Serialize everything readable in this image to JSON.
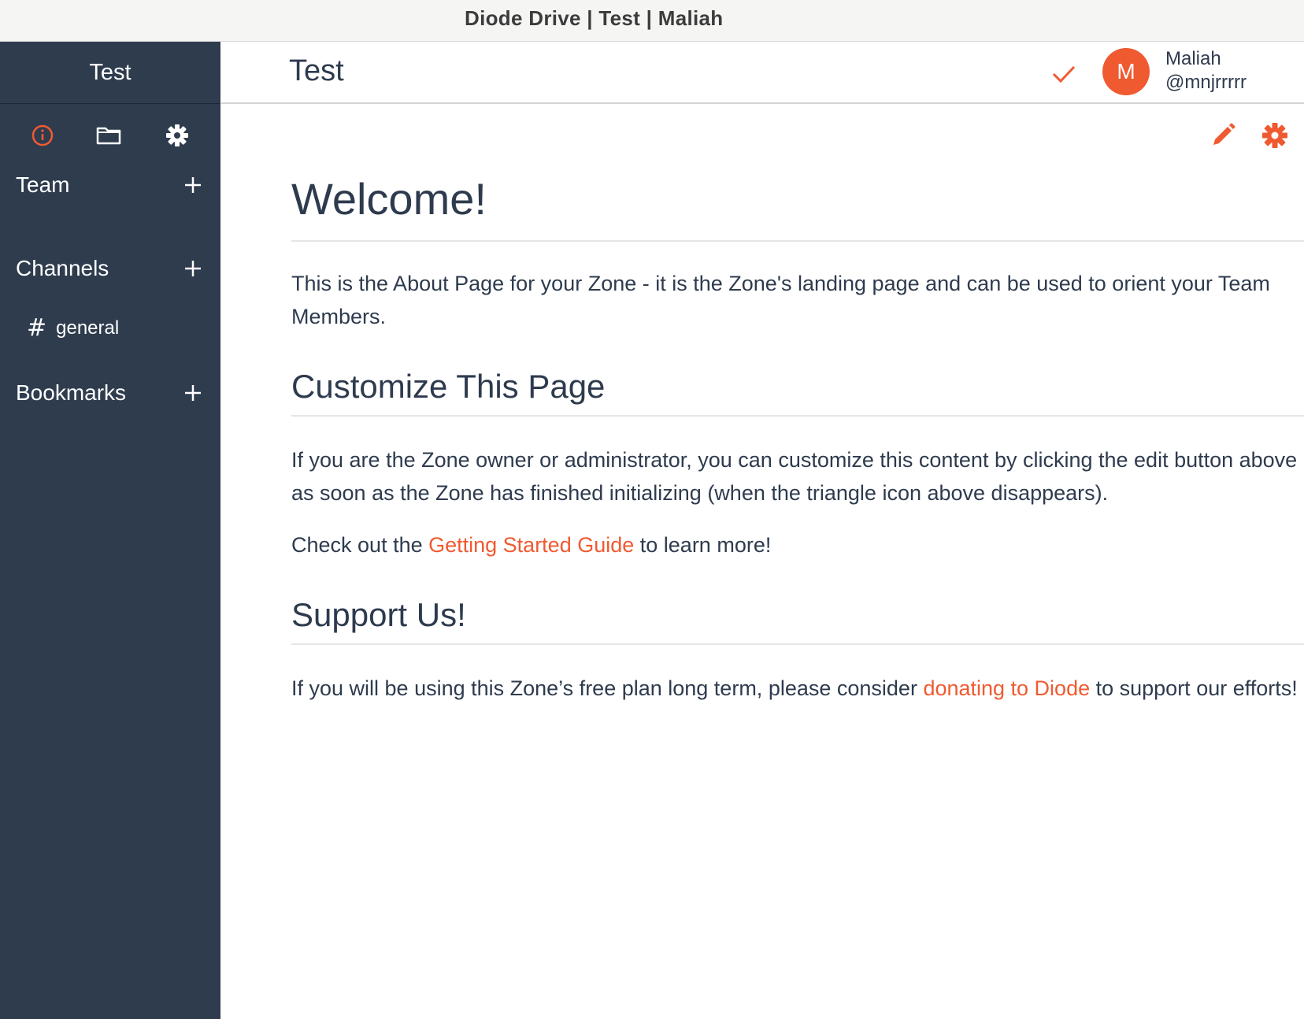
{
  "window": {
    "title": "Diode Drive | Test | Maliah"
  },
  "sidebar": {
    "zone_name": "Test",
    "tabs": [
      {
        "icon": "info-icon",
        "active": true
      },
      {
        "icon": "folder-icon",
        "active": false
      },
      {
        "icon": "gear-icon",
        "active": false
      }
    ],
    "sections": {
      "team": {
        "label": "Team"
      },
      "channels": {
        "label": "Channels",
        "items": [
          {
            "prefix": "#",
            "label": "general"
          }
        ]
      },
      "bookmarks": {
        "label": "Bookmarks"
      }
    }
  },
  "header": {
    "title": "Test",
    "status_icon": "checkmark-icon",
    "user": {
      "initial": "M",
      "name": "Maliah",
      "handle": "@mnjrrrrr"
    }
  },
  "toolbar": {
    "edit_icon": "pencil-icon",
    "settings_icon": "gear-icon"
  },
  "content": {
    "heading": "Welcome!",
    "intro": "This is the About Page for your Zone - it is the Zone's landing page and can be used to orient your Team Members.",
    "customize_heading": "Customize This Page",
    "customize_text": "If you are the Zone owner or administrator, you can customize this content by clicking the edit button above as soon as the Zone has finished initializing (when the triangle icon above disappears).",
    "guide_prefix": "Check out the ",
    "guide_link": "Getting Started Guide",
    "guide_suffix": " to learn more!",
    "support_heading": "Support Us!",
    "support_prefix": "If you will be using this Zone’s free plan long term, please consider ",
    "support_link": "donating to Diode",
    "support_suffix": " to support our efforts!"
  },
  "colors": {
    "accent": "#f05a30",
    "sidebar_bg": "#2e3c4e",
    "text": "#2e3b4e"
  }
}
